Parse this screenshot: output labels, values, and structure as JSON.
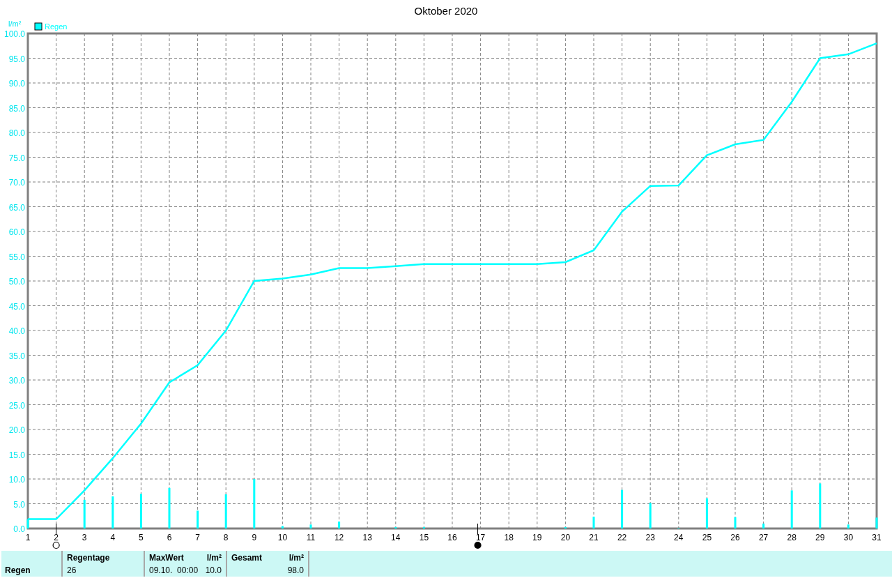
{
  "chart_data": {
    "type": "line",
    "title": "Oktober 2020",
    "ylabel": "l/m²",
    "x": [
      1,
      2,
      3,
      4,
      5,
      6,
      7,
      8,
      9,
      10,
      11,
      12,
      13,
      14,
      15,
      16,
      17,
      18,
      19,
      20,
      21,
      22,
      23,
      24,
      25,
      26,
      27,
      28,
      29,
      30,
      31
    ],
    "xlim": [
      1,
      31
    ],
    "ylim": [
      0,
      100
    ],
    "xticks": [
      1,
      2,
      3,
      4,
      5,
      6,
      7,
      8,
      9,
      10,
      11,
      12,
      13,
      14,
      15,
      16,
      17,
      18,
      19,
      20,
      21,
      22,
      23,
      24,
      25,
      26,
      27,
      28,
      29,
      30,
      31
    ],
    "yticks": [
      {
        "value": 0,
        "label": "0.0"
      },
      {
        "value": 5,
        "label": "5.0"
      },
      {
        "value": 10,
        "label": "10.0"
      },
      {
        "value": 15,
        "label": "15.0"
      },
      {
        "value": 20,
        "label": "20.0"
      },
      {
        "value": 25,
        "label": "25.0"
      },
      {
        "value": 30,
        "label": "30.0"
      },
      {
        "value": 35,
        "label": "35.0"
      },
      {
        "value": 40,
        "label": "40.0"
      },
      {
        "value": 45,
        "label": "45.0"
      },
      {
        "value": 50,
        "label": "50.0"
      },
      {
        "value": 55,
        "label": "55.0"
      },
      {
        "value": 60,
        "label": "60.0"
      },
      {
        "value": 65,
        "label": "65.0"
      },
      {
        "value": 70,
        "label": "70.0"
      },
      {
        "value": 75,
        "label": "75.0"
      },
      {
        "value": 80,
        "label": "80.0"
      },
      {
        "value": 85,
        "label": "85.0"
      },
      {
        "value": 90,
        "label": "90.0"
      },
      {
        "value": 95,
        "label": "95.0"
      },
      {
        "value": 100,
        "label": "100.0"
      }
    ],
    "series": [
      {
        "name": "Regen",
        "color": "#00ffff",
        "values": [
          1.9,
          1.9,
          7.7,
          14.2,
          21.2,
          29.5,
          33.0,
          40.0,
          50.0,
          50.5,
          51.3,
          52.6,
          52.6,
          53.0,
          53.4,
          53.4,
          53.4,
          53.4,
          53.4,
          53.8,
          56.2,
          64.0,
          69.2,
          69.3,
          75.4,
          77.6,
          78.5,
          86.2,
          95.0,
          95.8,
          98.0
        ]
      },
      {
        "type": "bar",
        "color": "#00ffff",
        "values": [
          1.9,
          0,
          5.8,
          6.5,
          7.0,
          8.2,
          3.6,
          6.9,
          10.0,
          0.5,
          0.8,
          1.4,
          0,
          0.3,
          0.3,
          0,
          0,
          0,
          0,
          0.3,
          2.4,
          7.8,
          5.2,
          0.1,
          6.1,
          2.3,
          1.0,
          7.7,
          9.1,
          0.8,
          2.2
        ]
      }
    ],
    "grid": true
  },
  "moon_markers": [
    {
      "filled": false
    },
    {
      "filled": true
    }
  ],
  "summary": {
    "row_label": "Regen",
    "groups": [
      {
        "label": "Regentage",
        "values": [
          "26"
        ]
      },
      {
        "label": "MaxWert",
        "unit": "l/m²",
        "values": [
          "09.10.  00:00",
          "10.0"
        ]
      },
      {
        "label": "Gesamt",
        "unit": "l/m²",
        "values": [
          "98.0"
        ]
      }
    ]
  }
}
